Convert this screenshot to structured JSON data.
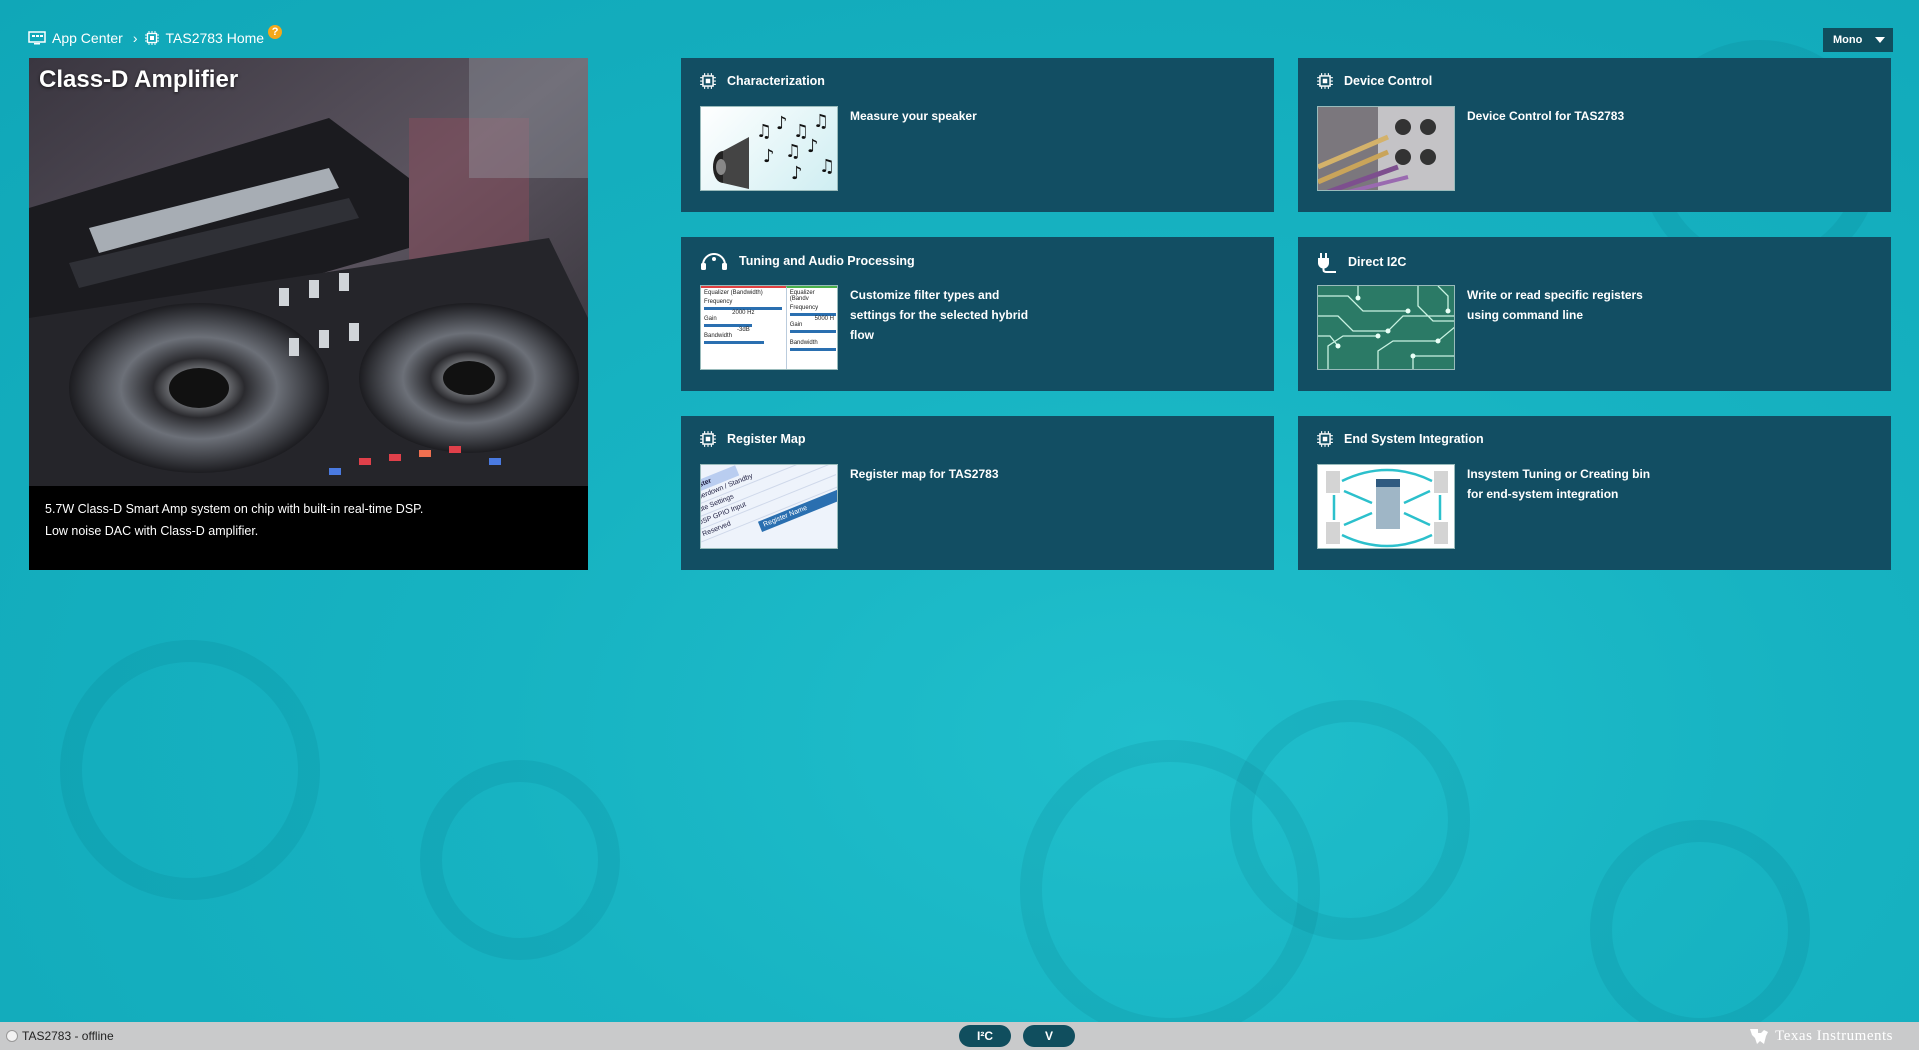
{
  "breadcrumb": {
    "app_center": "App Center",
    "separator": "›",
    "home": "TAS2783 Home",
    "help": "?"
  },
  "mode_select": {
    "value": "Mono"
  },
  "hero": {
    "title": "Class-D Amplifier",
    "desc_line1": "5.7W Class-D Smart Amp system on chip with built-in real-time DSP.",
    "desc_line2": "Low noise DAC with Class-D amplifier."
  },
  "tiles": [
    {
      "title": "Characterization",
      "desc": "Measure your speaker",
      "icon": "chip-icon"
    },
    {
      "title": "Device Control",
      "desc": "Device Control for TAS2783",
      "icon": "chip-icon"
    },
    {
      "title": "Tuning and Audio Processing",
      "desc": "Customize filter types and settings for the selected hybrid flow",
      "icon": "headset-icon"
    },
    {
      "title": "Direct I2C",
      "desc": "Write or read specific registers using command line",
      "icon": "plug-icon"
    },
    {
      "title": "Register Map",
      "desc": "Register map for TAS2783",
      "icon": "chip-icon"
    },
    {
      "title": "End System Integration",
      "desc": "Insystem Tuning or Creating bin for end-system integration",
      "icon": "chip-icon"
    }
  ],
  "thumb_text": {
    "eq_label": "Equalizer (Bandwidth)",
    "eq_label_short": "Equalizer (Bandv",
    "frequency": "Frequency",
    "freq_val1": "2000 Hz",
    "freq_val2": "5000 H",
    "gain": "Gain",
    "gain_val": "-3dB",
    "bandwidth": "Bandwidth",
    "reg_header": "Register",
    "reg_name": "Register Name",
    "reg_rows": [
      "Powerdown / Standby",
      "Mute Settings",
      "DSP GPIO Input",
      "Reserved"
    ]
  },
  "statusbar": {
    "status": "TAS2783 - offline",
    "btn_i2c": "I²C",
    "btn_v": "V",
    "brand": "Texas Instruments"
  },
  "colors": {
    "background": "#17b3c2",
    "tile": "#124e63",
    "pill": "#104e5e",
    "help": "#f3a81b",
    "statusbar": "#c9cacb"
  }
}
